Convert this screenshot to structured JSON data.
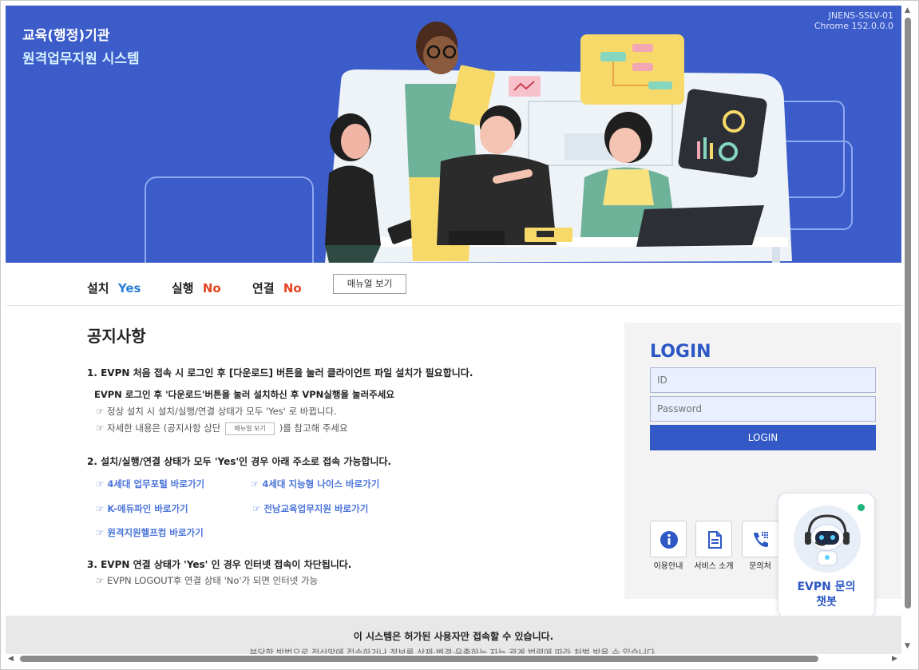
{
  "hero": {
    "title": "교육(행정)기관",
    "subtitle": "원격업무지원 시스템",
    "server_id": "JNENS-SSLV-01",
    "browser": "Chrome 152.0.0.0"
  },
  "status": {
    "install_label": "설치",
    "install_value": "Yes",
    "run_label": "실행",
    "run_value": "No",
    "connect_label": "연결",
    "connect_value": "No",
    "manual_button": "매뉴얼 보기",
    "colors": {
      "yes": "#2a7fd6",
      "no": "#e4431f"
    }
  },
  "notice": {
    "title": "공지사항",
    "item1": "1. EVPN 처음 접속 시 로그인 후 [다운로드] 버튼을 눌러 클라이언트 파일 설치가 필요합니다.",
    "item1_sub": "EVPN 로그인 후 '다운로드'버튼을 눌러 설치하신 후 VPN실행을 눌러주세요",
    "item1_note1": "☞ 정상 설치 시 설치/실행/연결 상태가 모두 'Yes' 로 바뀝니다.",
    "item1_note2_pre": "☞ 자세한 내용은 (공지사항 상단",
    "item1_note2_btn": "매뉴얼 보기",
    "item1_note2_post": ")를 참고해 주세요",
    "item2": "2. 설치/실행/연결 상태가 모두 'Yes'인 경우 아래 주소로 접속 가능합니다.",
    "links": [
      "☞ 4세대 업무포털 바로가기",
      "☞ 4세대 지능형 나이스 바로가기",
      "☞ K-에듀파인 바로가기",
      "☞ 전남교육업무지원 바로가기",
      "☞ 원격지원헬프컴 바로가기"
    ],
    "item3": "3. EVPN 연결 상태가 'Yes' 인 경우 인터넷 접속이 차단됩니다.",
    "item3_note": "☞ EVPN LOGOUT후 연결 상태 'No'가 되면 인터넷 가능"
  },
  "login": {
    "title": "LOGIN",
    "id_placeholder": "ID",
    "pw_placeholder": "Password",
    "button": "LOGIN",
    "quick": [
      {
        "label": "이용안내",
        "icon": "info-icon"
      },
      {
        "label": "서비스 소개",
        "icon": "document-icon"
      },
      {
        "label": "문의처",
        "icon": "phone-icon"
      }
    ],
    "accent": "#2c57c5"
  },
  "chatbot": {
    "line1": "EVPN 문의",
    "line2": "챗봇",
    "icon": "robot-icon"
  },
  "footer": {
    "main": "이 시스템은 허가된 사용자만 접속할 수 있습니다.",
    "cut": "부당한 방법으로 전산망에 접속하거나 정보를 삭제·변경·유출하는 자는 관계 법령에 따라 처벌 받을 수 있습니다."
  }
}
